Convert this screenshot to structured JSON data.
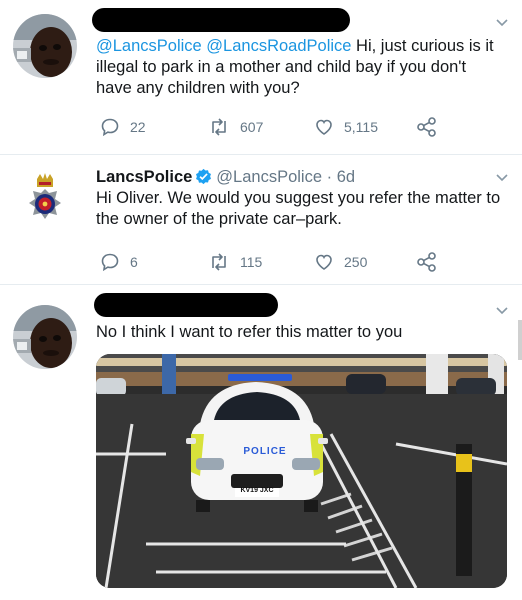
{
  "tweets": [
    {
      "mentions": "@LancsPolice @LancsRoadPolice",
      "text": " Hi, just curious is it illegal to park in a mother and child bay if you don't have any children with you?",
      "replies": "22",
      "retweets": "607",
      "likes": "5,115"
    },
    {
      "name": "LancsPolice",
      "handle": "@LancsPolice",
      "time": "· 6d",
      "text": "Hi Oliver. We would you suggest you refer the matter to the owner of the private car–park.",
      "replies": "6",
      "retweets": "115",
      "likes": "250"
    },
    {
      "text": "No I think I want to refer this matter to you",
      "photo": {
        "vehicle_label": "POLICE",
        "plate": "KV19 JXC"
      }
    }
  ],
  "colors": {
    "accent": "#1b95e0",
    "icon_gray": "#657786",
    "police_yellow": "#d8e23a",
    "police_blue": "#2a5bd7"
  }
}
